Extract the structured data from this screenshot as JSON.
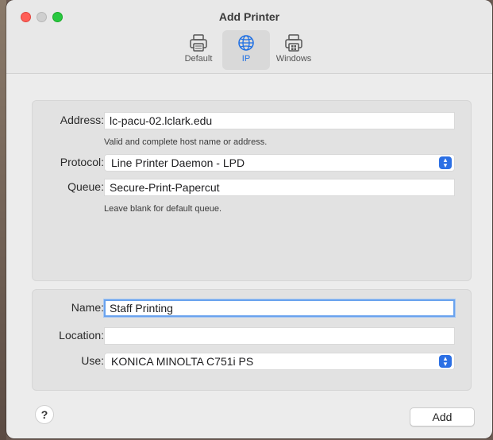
{
  "window": {
    "title": "Add Printer"
  },
  "tabs": [
    {
      "label": "Default",
      "icon": "printer-icon",
      "selected": false
    },
    {
      "label": "IP",
      "icon": "globe-icon",
      "selected": true
    },
    {
      "label": "Windows",
      "icon": "windows-printer-icon",
      "selected": false
    }
  ],
  "connection": {
    "address_label": "Address:",
    "address_value": "lc-pacu-02.lclark.edu",
    "address_hint": "Valid and complete host name or address.",
    "protocol_label": "Protocol:",
    "protocol_value": "Line Printer Daemon - LPD",
    "queue_label": "Queue:",
    "queue_value": "Secure-Print-Papercut",
    "queue_hint": "Leave blank for default queue."
  },
  "details": {
    "name_label": "Name:",
    "name_value": "Staff Printing",
    "location_label": "Location:",
    "location_value": "",
    "use_label": "Use:",
    "use_value": "KONICA MINOLTA C751i PS"
  },
  "footer": {
    "help_label": "?",
    "add_label": "Add"
  },
  "colors": {
    "accent": "#2b6fe4",
    "close": "#ff5f57",
    "zoom": "#28c840"
  }
}
